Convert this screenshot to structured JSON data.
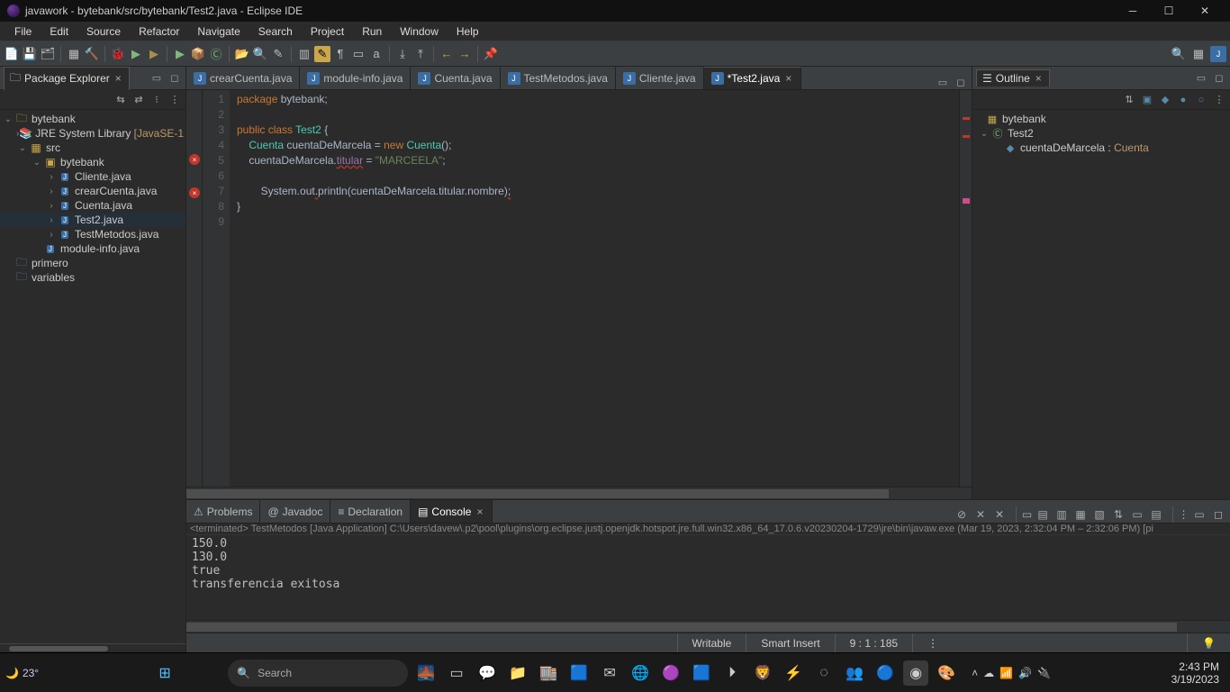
{
  "window": {
    "title": "javawork - bytebank/src/bytebank/Test2.java - Eclipse IDE"
  },
  "menu": [
    "File",
    "Edit",
    "Source",
    "Refactor",
    "Navigate",
    "Search",
    "Project",
    "Run",
    "Window",
    "Help"
  ],
  "package_explorer": {
    "title": "Package Explorer",
    "project": "bytebank",
    "jre": "JRE System Library",
    "jre_suffix": "[JavaSE-1",
    "src": "src",
    "pkg": "bytebank",
    "files": [
      "Cliente.java",
      "crearCuenta.java",
      "Cuenta.java",
      "Test2.java",
      "TestMetodos.java"
    ],
    "module": "module-info.java",
    "primero": "primero",
    "variables": "variables"
  },
  "editor_tabs": [
    "crearCuenta.java",
    "module-info.java",
    "Cuenta.java",
    "TestMetodos.java",
    "Cliente.java",
    "*Test2.java"
  ],
  "active_tab_index": 5,
  "code": {
    "lines": [
      {
        "n": 1,
        "html": "<span class='code-kw'>package</span> bytebank;"
      },
      {
        "n": 2,
        "html": ""
      },
      {
        "n": 3,
        "html": "<span class='code-kw'>public</span> <span class='code-kw'>class</span> <span class='code-type'>Test2</span> {"
      },
      {
        "n": 4,
        "html": "    <span class='code-type'>Cuenta</span> cuentaDeMarcela = <span class='code-kw'>new</span> <span class='code-type'>Cuenta</span>();"
      },
      {
        "n": 5,
        "html": "    cuentaDeMarcela.<span class='code-field code-err'>titular</span> = <span class='code-str'>\"MARCEELA\"</span>;",
        "err": true
      },
      {
        "n": 6,
        "html": ""
      },
      {
        "n": 7,
        "html": "        System.out<span class='code-err'>.</span>println(cuentaDeMarcela.titular.nombre)<span class='code-err'>;</span>",
        "err": true
      },
      {
        "n": 8,
        "html": "}"
      },
      {
        "n": 9,
        "html": ""
      }
    ]
  },
  "outline": {
    "title": "Outline",
    "pkg": "bytebank",
    "cls": "Test2",
    "field": "cuentaDeMarcela",
    "ftype": "Cuenta"
  },
  "bottom_tabs": [
    "Problems",
    "Javadoc",
    "Declaration",
    "Console"
  ],
  "bottom_active": 3,
  "console": {
    "terminated": "<terminated> TestMetodos [Java Application] C:\\Users\\davew\\.p2\\pool\\plugins\\org.eclipse.justj.openjdk.hotspot.jre.full.win32.x86_64_17.0.6.v20230204-1729\\jre\\bin\\javaw.exe  (Mar 19, 2023, 2:32:04 PM – 2:32:06 PM) [pi",
    "out": "150.0\n130.0\ntrue\ntransferencia exitosa"
  },
  "status": {
    "writable": "Writable",
    "insert": "Smart Insert",
    "pos": "9 : 1 : 185"
  },
  "taskbar": {
    "weather": "23°",
    "search": "Search",
    "time": "2:43 PM",
    "date": "3/19/2023"
  }
}
